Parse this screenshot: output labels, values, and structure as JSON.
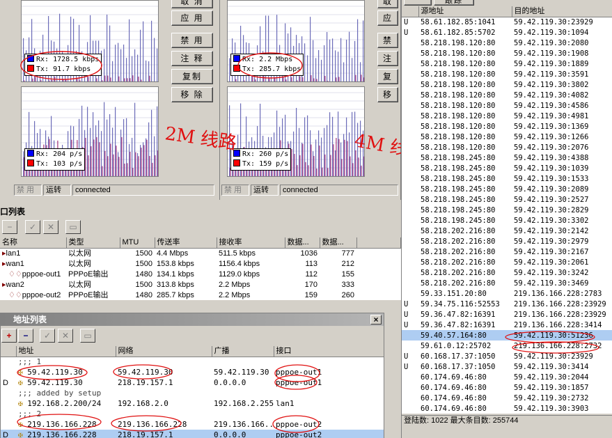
{
  "monitor_left": {
    "buttons": [
      "取 消",
      "应 用",
      "禁 用",
      "注 释",
      "复制",
      "移 除"
    ],
    "traffic": {
      "rx_label": "Rx:",
      "rx": "1728.5 kbps",
      "tx_label": "Tx:",
      "tx": "91.7 kbps"
    },
    "packets": {
      "rx_label": "Rx:",
      "rx": "204 p/s",
      "tx_label": "Tx:",
      "tx": "103 p/s"
    },
    "status": {
      "disabled": "禁 用",
      "running": "运转",
      "state": "connected"
    }
  },
  "monitor_right": {
    "buttons": [
      "取",
      "应",
      "禁",
      "注",
      "复",
      "移"
    ],
    "traffic": {
      "rx_label": "Rx:",
      "rx": "2.2 Mbps",
      "tx_label": "Tx:",
      "tx": "285.7 kbps"
    },
    "packets": {
      "rx_label": "Rx:",
      "rx": "260 p/s",
      "tx_label": "Tx:",
      "tx": "159 p/s"
    },
    "status": {
      "disabled": "禁 用",
      "running": "运转",
      "state": "connected"
    }
  },
  "colors": {
    "rx": "#0000ff",
    "tx": "#ff0000",
    "graph_bar": "#6b6bb8",
    "graph_tx": "#a0307a",
    "annotation": "#e01010",
    "selection": "#aecdf2"
  },
  "annotations": {
    "left_note": "2M 线路",
    "right_note": "4M 线路"
  },
  "interface_list": {
    "title": "口列表",
    "columns": [
      "名称",
      "类型",
      "MTU",
      "传送率",
      "接收率",
      "数据...",
      "数据..."
    ],
    "rows": [
      {
        "name": "lan1",
        "type": "以太网",
        "mtu": "1500",
        "tx": "4.4 Mbps",
        "rx": "511.5 kbps",
        "p1": "1036",
        "p2": "777"
      },
      {
        "name": "wan1",
        "type": "以太网",
        "mtu": "1500",
        "tx": "153.8 kbps",
        "rx": "1156.4 kbps",
        "p1": "113",
        "p2": "212"
      },
      {
        "name": "pppoe-out1",
        "type": "PPPoE输出",
        "mtu": "1480",
        "tx": "134.1 kbps",
        "rx": "1129.0 kbps",
        "p1": "112",
        "p2": "155"
      },
      {
        "name": "wan2",
        "type": "以太网",
        "mtu": "1500",
        "tx": "313.8 kbps",
        "rx": "2.2 Mbps",
        "p1": "170",
        "p2": "333"
      },
      {
        "name": "pppoe-out2",
        "type": "PPPoE输出",
        "mtu": "1480",
        "tx": "285.7 kbps",
        "rx": "2.2 Mbps",
        "p1": "159",
        "p2": "260"
      }
    ]
  },
  "address_list": {
    "title": "地址列表",
    "close": "×",
    "columns": [
      "地址",
      "网络",
      "广播",
      "接口"
    ],
    "rows": [
      {
        "flag": "",
        "comment": ";;; 1"
      },
      {
        "flag": "",
        "address": "59.42.119.30",
        "network": "59.42.119.30",
        "broadcast": "59.42.119.30",
        "interface": "pppoe-out1"
      },
      {
        "flag": "D",
        "address": "59.42.119.30",
        "network": "218.19.157.1",
        "broadcast": "0.0.0.0",
        "interface": "pppoe-out1"
      },
      {
        "flag": "",
        "comment": ";;; added by setup"
      },
      {
        "flag": "",
        "address": "192.168.2.200/24",
        "network": "192.168.2.0",
        "broadcast": "192.168.2.255",
        "interface": "lan1"
      },
      {
        "flag": "",
        "comment": ";;; 2"
      },
      {
        "flag": "",
        "address": "219.136.166.228",
        "network": "219.136.166.228",
        "broadcast": "219.136.166...",
        "interface": "pppoe-out2"
      },
      {
        "flag": "D",
        "address": "219.136.166.228",
        "network": "218.19.157.1",
        "broadcast": "0.0.0.0",
        "interface": "pppoe-out2"
      }
    ]
  },
  "connections": {
    "tabs": [
      "",
      "跟踪"
    ],
    "columns": [
      "源地址",
      "目的地址"
    ],
    "rows": [
      {
        "f": "U",
        "src": "58.61.182.85:1041",
        "dst": "59.42.119.30:23929"
      },
      {
        "f": "U",
        "src": "58.61.182.85:5702",
        "dst": "59.42.119.30:1094"
      },
      {
        "f": "",
        "src": "58.218.198.120:80",
        "dst": "59.42.119.30:2080"
      },
      {
        "f": "",
        "src": "58.218.198.120:80",
        "dst": "59.42.119.30:1908"
      },
      {
        "f": "",
        "src": "58.218.198.120:80",
        "dst": "59.42.119.30:1889"
      },
      {
        "f": "",
        "src": "58.218.198.120:80",
        "dst": "59.42.119.30:3591"
      },
      {
        "f": "",
        "src": "58.218.198.120:80",
        "dst": "59.42.119.30:3802"
      },
      {
        "f": "",
        "src": "58.218.198.120:80",
        "dst": "59.42.119.30:4082"
      },
      {
        "f": "",
        "src": "58.218.198.120:80",
        "dst": "59.42.119.30:4586"
      },
      {
        "f": "",
        "src": "58.218.198.120:80",
        "dst": "59.42.119.30:4981"
      },
      {
        "f": "",
        "src": "58.218.198.120:80",
        "dst": "59.42.119.30:1369"
      },
      {
        "f": "",
        "src": "58.218.198.120:80",
        "dst": "59.42.119.30:1266"
      },
      {
        "f": "",
        "src": "58.218.198.120:80",
        "dst": "59.42.119.30:2076"
      },
      {
        "f": "",
        "src": "58.218.198.245:80",
        "dst": "59.42.119.30:4388"
      },
      {
        "f": "",
        "src": "58.218.198.245:80",
        "dst": "59.42.119.30:1039"
      },
      {
        "f": "",
        "src": "58.218.198.245:80",
        "dst": "59.42.119.30:1533"
      },
      {
        "f": "",
        "src": "58.218.198.245:80",
        "dst": "59.42.119.30:2089"
      },
      {
        "f": "",
        "src": "58.218.198.245:80",
        "dst": "59.42.119.30:2527"
      },
      {
        "f": "",
        "src": "58.218.198.245:80",
        "dst": "59.42.119.30:2829"
      },
      {
        "f": "",
        "src": "58.218.198.245:80",
        "dst": "59.42.119.30:3302"
      },
      {
        "f": "",
        "src": "58.218.202.216:80",
        "dst": "59.42.119.30:2142"
      },
      {
        "f": "",
        "src": "58.218.202.216:80",
        "dst": "59.42.119.30:2979"
      },
      {
        "f": "",
        "src": "58.218.202.216:80",
        "dst": "59.42.119.30:2167"
      },
      {
        "f": "",
        "src": "58.218.202.216:80",
        "dst": "59.42.119.30:2061"
      },
      {
        "f": "",
        "src": "58.218.202.216:80",
        "dst": "59.42.119.30:3242"
      },
      {
        "f": "",
        "src": "58.218.202.216:80",
        "dst": "59.42.119.30:3469"
      },
      {
        "f": "",
        "src": "59.33.151.20:80",
        "dst": "219.136.166.228:2783"
      },
      {
        "f": "U",
        "src": "59.34.75.116:52553",
        "dst": "219.136.166.228:23929"
      },
      {
        "f": "U",
        "src": "59.36.47.82:16391",
        "dst": "219.136.166.228:23929"
      },
      {
        "f": "U",
        "src": "59.36.47.82:16391",
        "dst": "219.136.166.228:3414"
      },
      {
        "f": "",
        "src": "59.40.57.164:80",
        "dst": "59.42.119.30:51236",
        "hl": true
      },
      {
        "f": "",
        "src": "59.61.0.12:25702",
        "dst": "219.136.166.228:2732"
      },
      {
        "f": "U",
        "src": "60.168.17.37:1050",
        "dst": "59.42.119.30:23929"
      },
      {
        "f": "U",
        "src": "60.168.17.37:1050",
        "dst": "59.42.119.30:3414"
      },
      {
        "f": "",
        "src": "60.174.69.46:80",
        "dst": "59.42.119.30:2044"
      },
      {
        "f": "",
        "src": "60.174.69.46:80",
        "dst": "59.42.119.30:1857"
      },
      {
        "f": "",
        "src": "60.174.69.46:80",
        "dst": "59.42.119.30:2732"
      },
      {
        "f": "",
        "src": "60.174.69.46:80",
        "dst": "59.42.119.30:3903"
      }
    ],
    "footer": {
      "login_label": "登陆数:",
      "login": "1022",
      "max_label": "最大条目数:",
      "max": "255744"
    }
  }
}
